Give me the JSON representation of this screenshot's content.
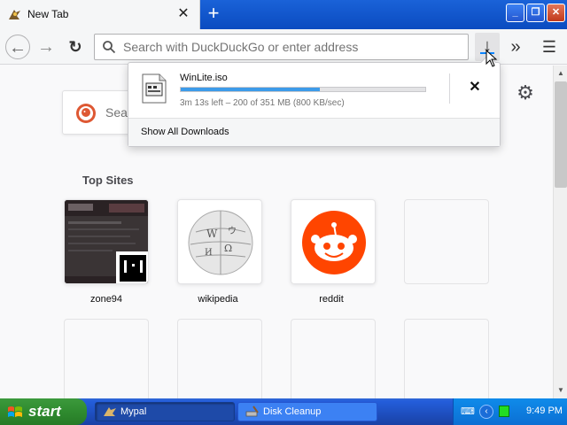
{
  "browser": {
    "tab": {
      "title": "New Tab",
      "close_glyph": "✕"
    },
    "new_tab_glyph": "+",
    "window_buttons": {
      "minimize": "_",
      "maximize": "❐",
      "close": "✕"
    }
  },
  "toolbar": {
    "back_glyph": "←",
    "forward_glyph": "→",
    "reload_glyph": "↻",
    "url_placeholder": "Search with DuckDuckGo or enter address",
    "url_value": "",
    "download_glyph": "↓",
    "overflow_glyph": "»",
    "menu_glyph": "☰"
  },
  "download_panel": {
    "filename": "WinLite.iso",
    "progress_fraction": 0.57,
    "status": "3m 13s left – 200 of 351 MB (800 KB/sec)",
    "cancel_glyph": "✕",
    "show_all_label": "Show All Downloads"
  },
  "page": {
    "search_placeholder": "Sear",
    "settings_glyph": "⚙",
    "top_sites_header": "Top Sites",
    "top_sites": [
      {
        "label": "zone94",
        "icon": "zone94-thumbnail"
      },
      {
        "label": "wikipedia",
        "icon": "wikipedia-globe-icon"
      },
      {
        "label": "reddit",
        "icon": "reddit-alien-icon"
      },
      {
        "label": "",
        "icon": ""
      }
    ],
    "empty_row_count_note": ""
  },
  "scrollbar": {
    "up_glyph": "▲",
    "down_glyph": "▼"
  },
  "taskbar": {
    "start_label": "start",
    "tasks": [
      {
        "label": "Mypal",
        "active": true
      },
      {
        "label": "Disk Cleanup",
        "active": false
      }
    ],
    "tray_chevron": "‹",
    "tray_kbd": "⌨",
    "clock": "9:49 PM"
  },
  "colors": {
    "titlebar_blue": "#1a62d8",
    "progress_blue": "#3d9be9",
    "reddit_orange": "#ff4500",
    "taskbar_blue": "#245edb",
    "start_green": "#3c9a3c"
  }
}
